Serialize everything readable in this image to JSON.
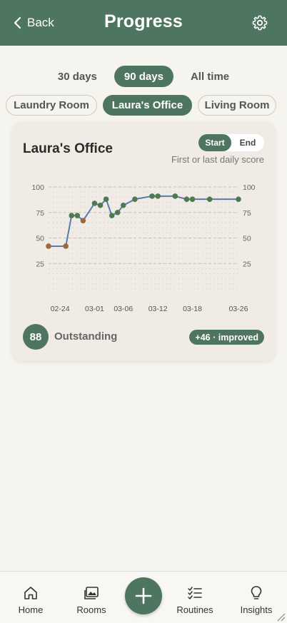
{
  "header": {
    "back_label": "Back",
    "title": "Progress",
    "back_icon": "chevron-left-icon",
    "settings_icon": "gear-icon"
  },
  "ranges": [
    {
      "label": "30 days",
      "active": false
    },
    {
      "label": "90 days",
      "active": true
    },
    {
      "label": "All time",
      "active": false
    }
  ],
  "rooms": [
    {
      "label": "Laundry Room",
      "active": false
    },
    {
      "label": "Laura's Office",
      "active": true
    },
    {
      "label": "Living Room",
      "active": false
    }
  ],
  "card": {
    "title": "Laura's Office",
    "toggle": {
      "start": "Start",
      "end": "End",
      "selected": "Start"
    },
    "subtitle": "First or last daily score",
    "score": "88",
    "score_label": "Outstanding",
    "change": "+46 · improved"
  },
  "chart_data": {
    "type": "line",
    "ylim": [
      0,
      100
    ],
    "y_ticks": [
      25,
      50,
      75,
      100
    ],
    "x_ticks": [
      "02-24",
      "03-01",
      "03-06",
      "03-12",
      "03-18",
      "03-26"
    ],
    "x": [
      "02-22",
      "02-25",
      "02-26",
      "02-27",
      "02-28",
      "03-01",
      "03-02",
      "03-03",
      "03-04",
      "03-05",
      "03-06",
      "03-08",
      "03-11",
      "03-12",
      "03-15",
      "03-17",
      "03-18",
      "03-21",
      "03-26"
    ],
    "values": [
      42,
      42,
      72,
      72,
      67,
      84,
      82,
      88,
      72,
      75,
      82,
      88,
      91,
      91,
      91,
      88,
      88,
      88,
      88
    ],
    "series_color": "#5b79b0",
    "point_colors": {
      "high": "#4e7a52",
      "low": "#a0673a"
    },
    "low_threshold": 70,
    "grid": true
  },
  "nav": [
    {
      "label": "Home",
      "icon": "home-icon"
    },
    {
      "label": "Rooms",
      "icon": "images-icon"
    },
    {
      "label": "Routines",
      "icon": "checklist-icon"
    },
    {
      "label": "Insights",
      "icon": "lightbulb-icon"
    }
  ],
  "fab": {
    "icon": "plus-icon"
  },
  "colors": {
    "primary": "#4e7560",
    "background": "#f6f4ef",
    "card": "#f0ebe4"
  }
}
